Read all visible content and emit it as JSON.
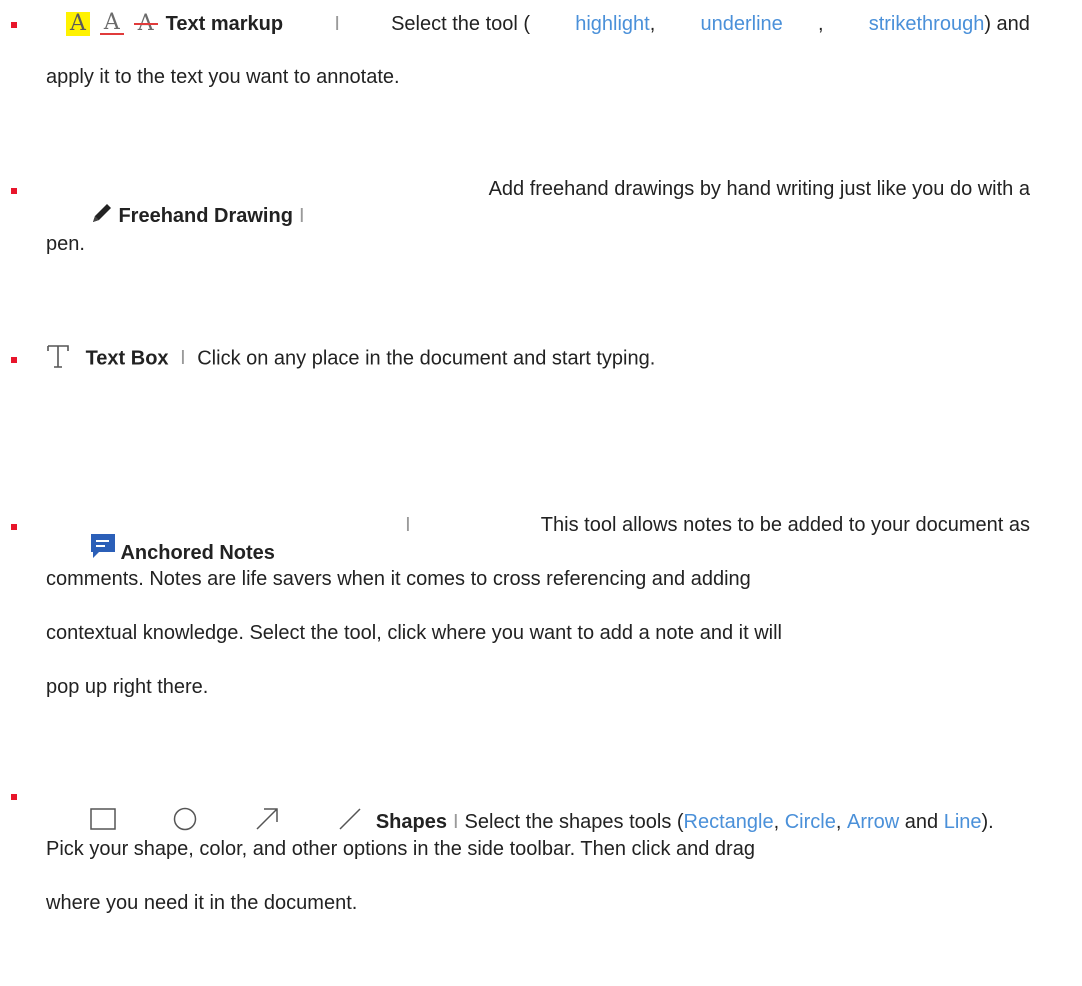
{
  "items": [
    {
      "icons": [
        "highlight-icon",
        "underline-icon",
        "strikethrough-icon"
      ],
      "title": "Text markup",
      "sep": "I",
      "text_before": "Select the tool (",
      "links": [
        "highlight",
        "underline",
        "strikethrough"
      ],
      "text_after": ") and",
      "line2": "apply it to the text you want to annotate."
    },
    {
      "icons": [
        "pencil-icon"
      ],
      "title": "Freehand Drawing",
      "sep": "I",
      "line1_text": "Add freehand drawings by hand writing just like you do with a",
      "line2": "pen."
    },
    {
      "icons": [
        "text-box-icon"
      ],
      "title": "Text Box",
      "sep": "I",
      "line1_text": "Click on any place in the document and start typing."
    },
    {
      "icons": [
        "note-icon"
      ],
      "title": "Anchored Notes",
      "sep": "I",
      "line1_text": "This tool allows notes to be added to your document as",
      "line2": "comments. Notes are life savers when it comes to cross referencing and adding",
      "line3": "contextual knowledge. Select the tool, click where you want to add a note and it will",
      "line4": "pop up right there."
    },
    {
      "icons": [
        "rectangle-icon",
        "circle-icon",
        "arrow-icon",
        "line-icon"
      ],
      "title": "Shapes",
      "sep": "I",
      "text_before": "Select the shapes tools (",
      "links": [
        "Rectangle",
        "Circle",
        "Arrow",
        "Line"
      ],
      "link_joiners": [
        ", ",
        ", ",
        " and "
      ],
      "text_after": ").",
      "line2": "Pick your shape, color, and other options in the side toolbar. Then click and drag",
      "line3": "where you need it in the document."
    }
  ],
  "colors": {
    "bullet": "#e8152b",
    "link": "#4a90d9",
    "highlight": "#fff200",
    "icon_gray": "#6b6b6b",
    "note": "#2b5fb8"
  }
}
